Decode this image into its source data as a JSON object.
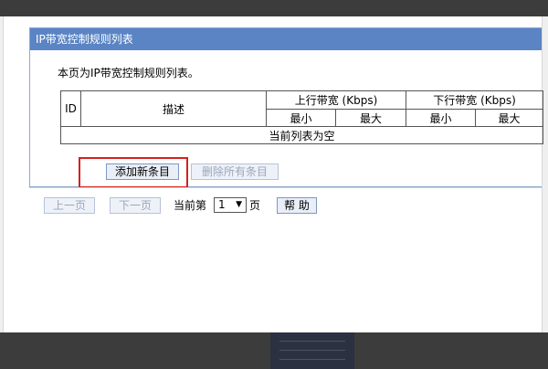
{
  "panel": {
    "title": "IP带宽控制规则列表",
    "intro": "本页为IP带宽控制规则列表。"
  },
  "table": {
    "col_id": "ID",
    "col_desc": "描述",
    "col_up": "上行带宽 (Kbps)",
    "col_down": "下行带宽 (Kbps)",
    "min": "最小",
    "max": "最大",
    "empty": "当前列表为空"
  },
  "buttons": {
    "add": "添加新条目",
    "delete_all": "删除所有条目"
  },
  "nav": {
    "prev": "上一页",
    "next": "下一页",
    "current_prefix": "当前第",
    "page": "1",
    "page_suffix": "页",
    "help": "帮 助"
  },
  "colors": {
    "title_bar": "#5a84c4",
    "highlight": "#d4211f"
  }
}
